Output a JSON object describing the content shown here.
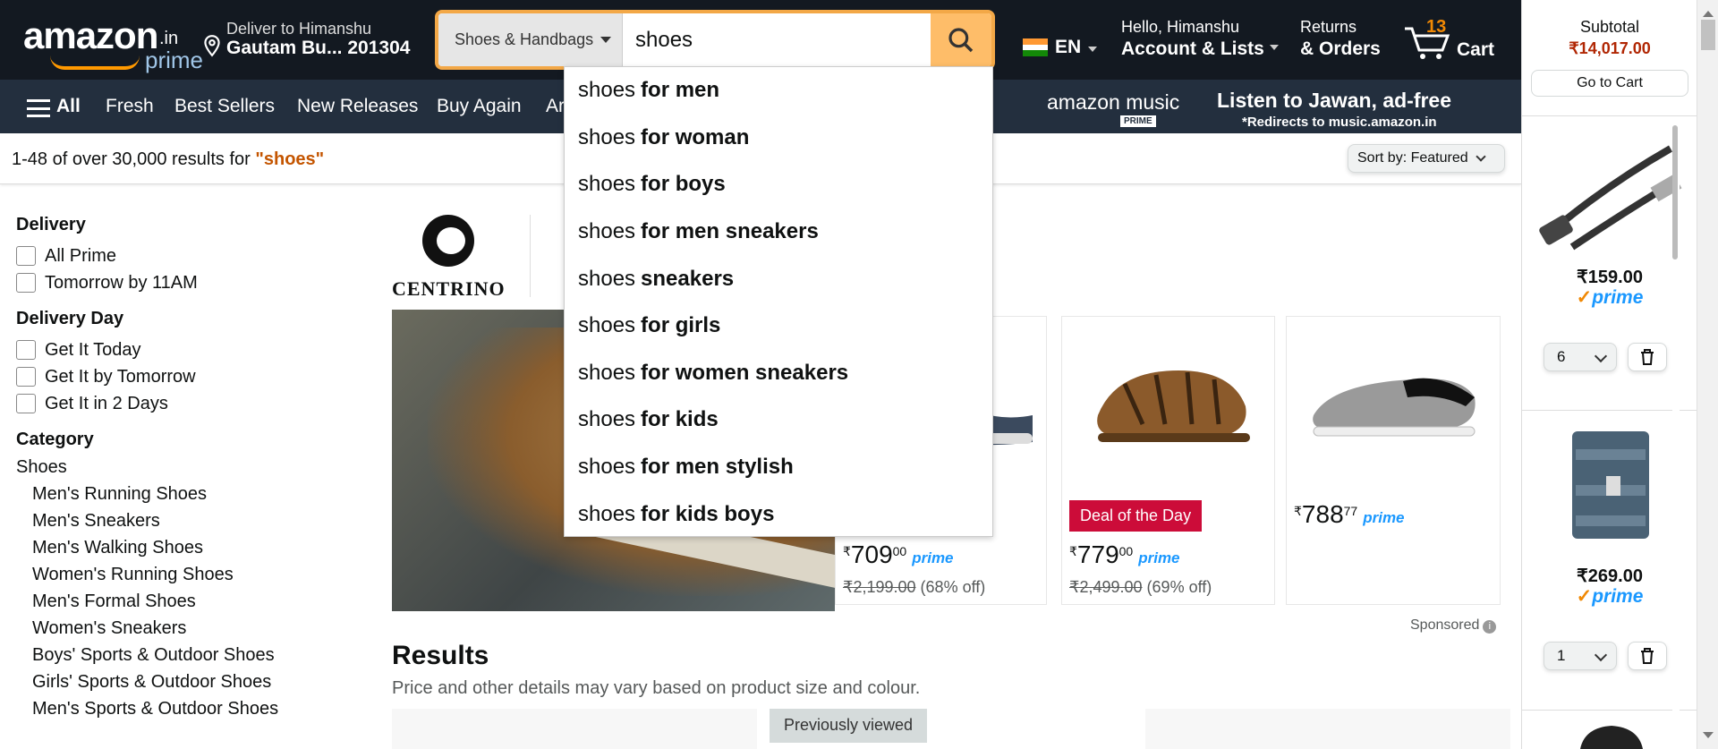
{
  "header": {
    "logo_text": "amazon",
    "logo_suffix": ".in",
    "logo_prime": "prime",
    "deliver_line1": "Deliver to Himanshu",
    "deliver_line2": "Gautam Bu... 201304",
    "search_category": "Shoes & Handbags",
    "search_value": "shoes",
    "lang": "EN",
    "account_line1": "Hello, Himanshu",
    "account_line2": "Account & Lists",
    "returns_line1": "Returns",
    "returns_line2": "& Orders",
    "cart_count": "13",
    "cart_label": "Cart",
    "colors": {
      "bg": "#131921",
      "accent": "#febd69",
      "cart_count": "#f08804"
    }
  },
  "nav": {
    "all": "All",
    "items": [
      "Fresh",
      "Best Sellers",
      "New Releases",
      "Buy Again",
      "Ar"
    ],
    "music_logo": "amazon music",
    "music_badge": "PRIME",
    "music_title": "Listen to Jawan, ad-free",
    "music_sub": "*Redirects to music.amazon.in"
  },
  "results_bar": {
    "text": "1-48 of over 30,000 results for ",
    "query": "\"shoes\"",
    "sort_label": "Sort by:",
    "sort_value": "Featured"
  },
  "suggestions": [
    {
      "prefix": "shoes",
      "bold": "for men"
    },
    {
      "prefix": "shoes",
      "bold": "for woman"
    },
    {
      "prefix": "shoes",
      "bold": "for boys"
    },
    {
      "prefix": "shoes",
      "bold": "for men sneakers"
    },
    {
      "prefix": "shoes",
      "bold": "sneakers"
    },
    {
      "prefix": "shoes",
      "bold": "for girls"
    },
    {
      "prefix": "shoes",
      "bold": "for women sneakers"
    },
    {
      "prefix": "shoes",
      "bold": "for kids"
    },
    {
      "prefix": "shoes",
      "bold": "for men stylish"
    },
    {
      "prefix": "shoes",
      "bold": "for kids boys"
    }
  ],
  "sidebar": {
    "delivery": {
      "title": "Delivery",
      "options": [
        "All Prime",
        "Tomorrow by 11AM"
      ]
    },
    "delivery_day": {
      "title": "Delivery Day",
      "options": [
        "Get It Today",
        "Get It by Tomorrow",
        "Get It in 2 Days"
      ]
    },
    "category": {
      "title": "Category",
      "root": "Shoes",
      "items": [
        "Men's Running Shoes",
        "Men's Sneakers",
        "Men's Walking Shoes",
        "Women's Running Shoes",
        "Men's Formal Shoes",
        "Women's Sneakers",
        "Boys' Sports & Outdoor Shoes",
        "Girls' Sports & Outdoor Shoes",
        "Men's Sports & Outdoor Shoes"
      ]
    }
  },
  "banner": {
    "brand": "CENTRINO",
    "cards": [
      {
        "deal": "",
        "price_symbol": "₹",
        "price_whole": "709",
        "price_frac": "00",
        "prime": "prime",
        "mrp": "₹2,199.00",
        "off": "(68% off)"
      },
      {
        "deal": "Deal of the Day",
        "price_symbol": "₹",
        "price_whole": "779",
        "price_frac": "00",
        "prime": "prime",
        "mrp": "₹2,499.00",
        "off": "(69% off)"
      },
      {
        "deal": "",
        "price_symbol": "₹",
        "price_whole": "788",
        "price_frac": "77",
        "prime": "prime",
        "mrp": "",
        "off": ""
      }
    ],
    "sponsored": "Sponsored"
  },
  "results": {
    "title": "Results",
    "subtitle": "Price and other details may vary based on product size and colour.",
    "previously_viewed": "Previously viewed"
  },
  "cart_panel": {
    "subtotal_label": "Subtotal",
    "subtotal_value": "₹14,017.00",
    "go_to_cart": "Go to Cart",
    "items": [
      {
        "price": "₹159.00",
        "prime": "prime",
        "qty": "6"
      },
      {
        "price": "₹269.00",
        "prime": "prime",
        "qty": "1"
      }
    ]
  }
}
